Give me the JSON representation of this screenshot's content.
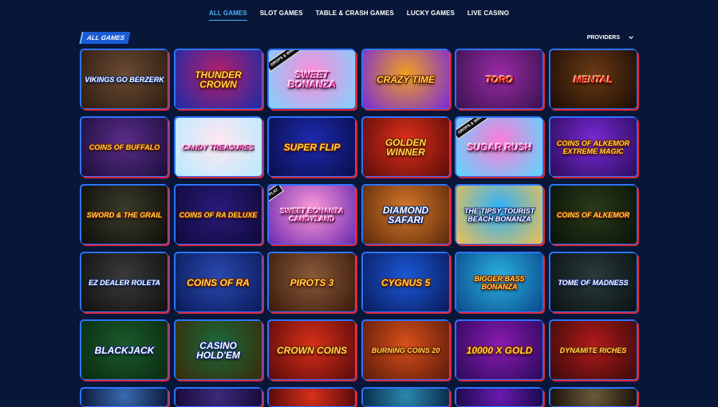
{
  "nav": {
    "items": [
      {
        "label": "ALL GAMES",
        "active": true
      },
      {
        "label": "SLOT GAMES",
        "active": false
      },
      {
        "label": "TABLE & CRASH GAMES",
        "active": false
      },
      {
        "label": "LUCKY GAMES",
        "active": false
      },
      {
        "label": "LIVE CASINO",
        "active": false
      }
    ]
  },
  "section": {
    "title": "ALL GAMES",
    "providers_label": "PROVIDERS"
  },
  "games": [
    {
      "title": "VIKINGS GO BERZERK",
      "bg": "#6a4a32",
      "bg2": "#2d1d12",
      "style": "white",
      "icon": "viking-icon"
    },
    {
      "title": "THUNDER CROWN",
      "bg": "#b91d6a",
      "bg2": "#1a2ca8",
      "style": "",
      "icon": "crown-icon"
    },
    {
      "title": "SWEET BONANZA",
      "bg": "#ff8ad8",
      "bg2": "#7fd3ff",
      "style": "pink",
      "icon": "candy-icon",
      "badge": "DROPS & WINS"
    },
    {
      "title": "CRAZY TIME",
      "bg": "#f0a020",
      "bg2": "#7a2ad8",
      "style": "",
      "icon": "wheel-icon"
    },
    {
      "title": "TORO",
      "bg": "#9a2aa6",
      "bg2": "#3a124e",
      "style": "red",
      "icon": "bull-icon"
    },
    {
      "title": "MENTAL",
      "bg": "#6a3a14",
      "bg2": "#1a0c04",
      "style": "red",
      "icon": "face-icon"
    },
    {
      "title": "COINS OF BUFFALO",
      "bg": "#5a2c8a",
      "bg2": "#1c0e3a",
      "style": "",
      "icon": "buffalo-icon"
    },
    {
      "title": "Candy Treasures",
      "bg": "#ffe7f0",
      "bg2": "#b8eaff",
      "style": "pink",
      "icon": "candy-icon"
    },
    {
      "title": "SUPER FLIP",
      "bg": "#1c2ab0",
      "bg2": "#0a0e4a",
      "style": "",
      "icon": "flip-icon"
    },
    {
      "title": "GOLDEN WINNER",
      "bg": "#e0301a",
      "bg2": "#5a0c0a",
      "style": "",
      "icon": "bell-icon"
    },
    {
      "title": "Sugar Rush",
      "bg": "#ff7ad6",
      "bg2": "#5ad8ff",
      "style": "pink",
      "icon": "gumball-icon",
      "badge": "DROPS & WINS"
    },
    {
      "title": "COINS OF ALKEMOR EXTREME MAGIC",
      "bg": "#7a2ad8",
      "bg2": "#2a0c5a",
      "style": "",
      "icon": "wizard-icon"
    },
    {
      "title": "SWORD & THE GRAIL",
      "bg": "#3a3a2a",
      "bg2": "#0e0e0a",
      "style": "",
      "icon": "sword-icon"
    },
    {
      "title": "COINS OF RA Deluxe",
      "bg": "#2a1a7a",
      "bg2": "#0e0a3a",
      "style": "",
      "icon": "pharaoh-icon"
    },
    {
      "title": "SWEET BONANZA CANDYLAND",
      "bg": "#ff9ad8",
      "bg2": "#6a2ab0",
      "style": "pink",
      "icon": "candy-icon",
      "badge": "PLAY"
    },
    {
      "title": "DIAMOND SAFARI",
      "bg": "#d8782a",
      "bg2": "#5a2a0a",
      "style": "white",
      "icon": "lion-icon"
    },
    {
      "title": "The Tipsy Tourist Beach Bonanza",
      "bg": "#2ab0ff",
      "bg2": "#f0c050",
      "style": "white",
      "icon": "tourist-icon"
    },
    {
      "title": "COINS OF ALKEMOR",
      "bg": "#2a3a1a",
      "bg2": "#0a1206",
      "style": "",
      "icon": "coin-icon"
    },
    {
      "title": "EZ Dealer Roleta",
      "bg": "#3a3a3a",
      "bg2": "#101010",
      "style": "white",
      "icon": "dealer-icon"
    },
    {
      "title": "COINS OF RA",
      "bg": "#2a4ab0",
      "bg2": "#0a1a5a",
      "style": "",
      "icon": "pharaoh-icon"
    },
    {
      "title": "PIROTS 3",
      "bg": "#8a5a3a",
      "bg2": "#3a1a0a",
      "style": "",
      "icon": "bird-icon"
    },
    {
      "title": "CYGNUS 5",
      "bg": "#1a5ad8",
      "bg2": "#0a1a5a",
      "style": "",
      "icon": "star-icon"
    },
    {
      "title": "BIGGER BASS BONANZA",
      "bg": "#2ab0e0",
      "bg2": "#0a4a8a",
      "style": "",
      "icon": "fish-icon"
    },
    {
      "title": "TOME OF MADNESS",
      "bg": "#2a3a3a",
      "bg2": "#0a1212",
      "style": "white",
      "icon": "book-icon"
    },
    {
      "title": "Blackjack",
      "bg": "#1a5a2a",
      "bg2": "#0a2a12",
      "style": "white",
      "icon": "cards-icon"
    },
    {
      "title": "Casino Hold'em",
      "bg": "#1a6a3a",
      "bg2": "#3a2a0a",
      "style": "white",
      "icon": "cards-icon"
    },
    {
      "title": "CROWN COINS",
      "bg": "#d8301a",
      "bg2": "#5a0a0a",
      "style": "",
      "icon": "cherry-icon"
    },
    {
      "title": "BURNING COINS 20",
      "bg": "#d8501a",
      "bg2": "#5a1a0a",
      "style": "",
      "icon": "fire-icon"
    },
    {
      "title": "10000 X GOLD",
      "bg": "#8a1ab0",
      "bg2": "#2a0a5a",
      "style": "",
      "icon": "x-icon"
    },
    {
      "title": "DYNAMITE RICHES",
      "bg": "#b01a1a",
      "bg2": "#3a0a0a",
      "style": "",
      "icon": "chest-icon"
    },
    {
      "title": "",
      "bg": "#3a6ab0",
      "bg2": "#0a1a3a",
      "style": "",
      "icon": "game-icon"
    },
    {
      "title": "",
      "bg": "#3a2a7a",
      "bg2": "#1a0a3a",
      "style": "",
      "icon": "game-icon"
    },
    {
      "title": "",
      "bg": "#d8301a",
      "bg2": "#5a0a0a",
      "style": "",
      "icon": "game-icon"
    },
    {
      "title": "",
      "bg": "#2a8ab0",
      "bg2": "#0a2a4a",
      "style": "",
      "icon": "game-icon"
    },
    {
      "title": "",
      "bg": "#6a1ab0",
      "bg2": "#1a0a4a",
      "style": "",
      "icon": "game-icon"
    },
    {
      "title": "",
      "bg": "#6a5a3a",
      "bg2": "#1a120a",
      "style": "",
      "icon": "game-icon"
    }
  ]
}
